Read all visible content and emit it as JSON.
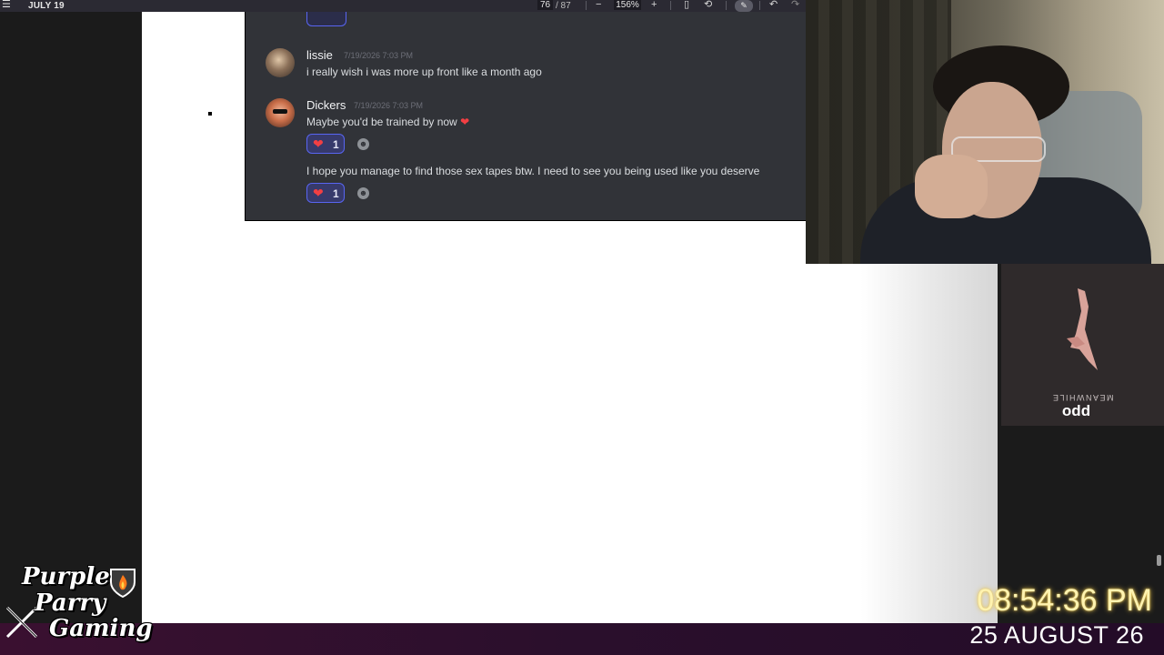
{
  "viewer": {
    "title": "JULY 19",
    "page_current": "76",
    "page_total": "/ 87",
    "zoom": "156%",
    "icons": [
      "menu-icon",
      "zoom-out-icon",
      "zoom-in-icon",
      "page-fit-icon",
      "rotate-icon",
      "draw-icon",
      "undo-icon",
      "redo-icon"
    ]
  },
  "chat": {
    "messages": [
      {
        "author": "lissie",
        "timestamp": "7/19/2026 7:03 PM",
        "lines": [
          "i really wish i was more up front like a month ago"
        ]
      },
      {
        "author": "Dickers",
        "timestamp": "7/19/2026 7:03 PM",
        "lines": [
          "Maybe you'd be trained by now",
          "I hope you manage to find those sex tapes btw. I need to see you being used like you deserve"
        ],
        "reactions": [
          {
            "emoji": "❤",
            "count": "1"
          },
          {
            "emoji": "❤",
            "count": "1"
          }
        ]
      }
    ]
  },
  "music": {
    "album": "MEANWHILE",
    "artist": "odd"
  },
  "logo": {
    "line1": "Purple",
    "line2": "Parry",
    "line3": "Gaming"
  },
  "clock": {
    "time": "08:54:36 PM",
    "date": "25 AUGUST 26"
  },
  "colors": {
    "accent_yellow": "#fff3b0",
    "discord_bg": "#313338",
    "reaction_border": "#5865f2",
    "heart": "#f23f43"
  }
}
